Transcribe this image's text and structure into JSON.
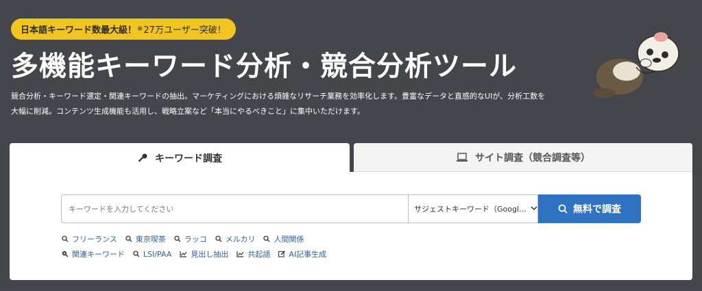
{
  "badge": {
    "text_pre": "日本語キーワード数最大級！",
    "sup": "※",
    "text_post": "27万ユーザー突破！"
  },
  "hero": {
    "title": "多機能キーワード分析・競合分析ツール",
    "description": "競合分析・キーワード選定・関連キーワードの抽出。マーケティングにおける煩雑なリサーチ業務を効率化します。豊富なデータと直感的なUIが、分析工数を大幅に削減。コンテンツ生成機能も活用し、戦略立案など「本当にやるべきこと」に集中いただけます。"
  },
  "tabs": [
    {
      "label": "キーワード調査",
      "icon": "key-icon",
      "active": true
    },
    {
      "label": "サイト調査（競合調査等）",
      "icon": "laptop-icon",
      "active": false
    }
  ],
  "search": {
    "placeholder": "キーワードを入力してください",
    "value": "",
    "type_selected": "サジェストキーワード（Googl…",
    "button_label": "無料で調査"
  },
  "example_links": [
    {
      "label": "フリーランス",
      "icon": "search-icon"
    },
    {
      "label": "東京喫茶",
      "icon": "search-icon"
    },
    {
      "label": "ラッコ",
      "icon": "search-icon"
    },
    {
      "label": "メルカリ",
      "icon": "search-icon"
    },
    {
      "label": "人間関係",
      "icon": "search-icon"
    }
  ],
  "tool_links": [
    {
      "label": "関連キーワード",
      "icon": "search-plus-icon"
    },
    {
      "label": "LSI/PAA",
      "icon": "search-icon"
    },
    {
      "label": "見出し抽出",
      "icon": "chart-icon"
    },
    {
      "label": "共起語",
      "icon": "chart-icon"
    },
    {
      "label": "AI記事生成",
      "icon": "edit-icon"
    }
  ],
  "colors": {
    "background": "#45464b",
    "badge": "#f2c420",
    "accent": "#2f72c4",
    "link": "#2d5f9e"
  }
}
